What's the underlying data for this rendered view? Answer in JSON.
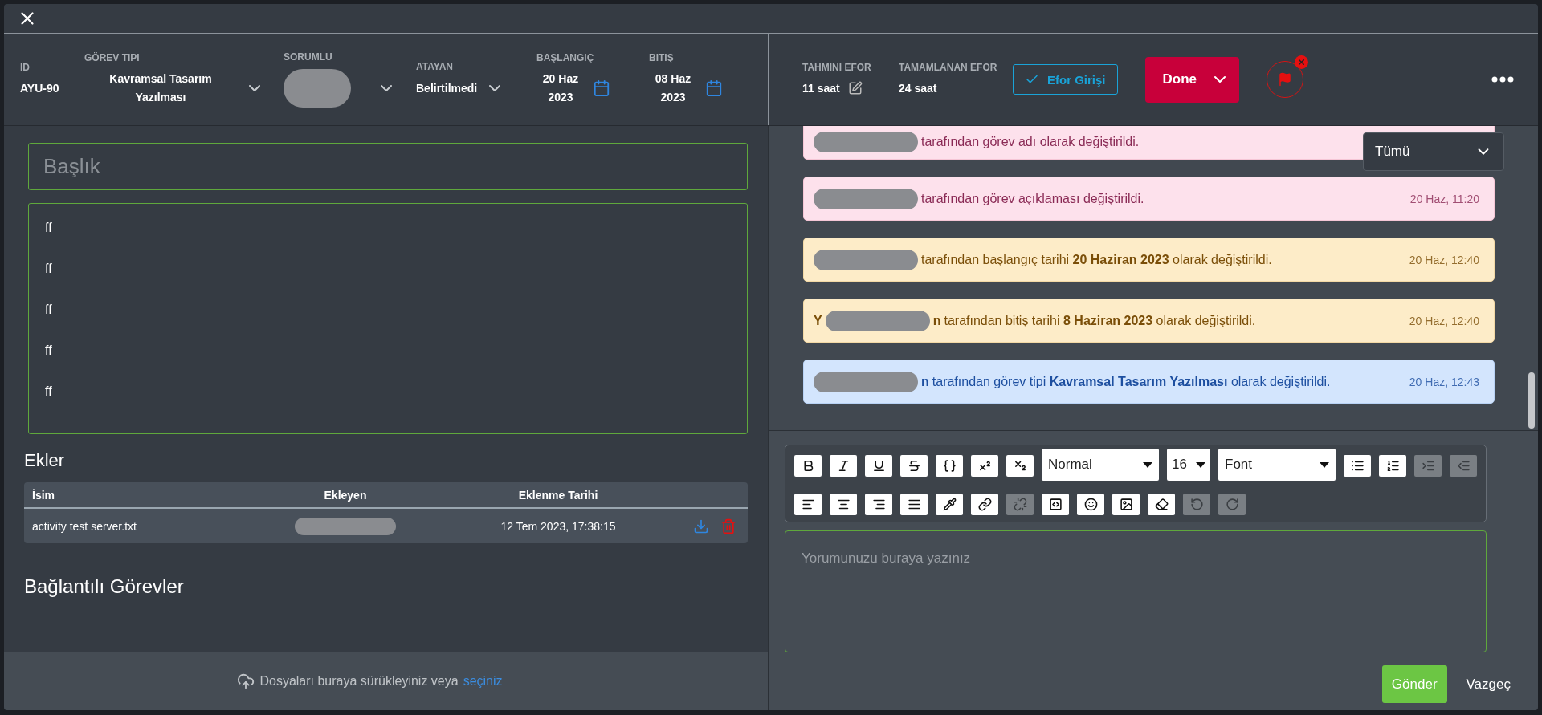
{
  "header": {
    "id": {
      "label": "ID",
      "value": "AYU-90"
    },
    "task_type": {
      "label": "GÖREV TIPI",
      "value": "Kavramsal Tasarım Yazılması"
    },
    "responsible": {
      "label": "SORUMLU"
    },
    "assigner": {
      "label": "ATAYAN",
      "value": "Belirtilmedi"
    },
    "start": {
      "label": "BAŞLANGIÇ",
      "value": "20 Haz 2023"
    },
    "end": {
      "label": "BITIŞ",
      "value": "08 Haz 2023"
    },
    "estimated": {
      "label": "TAHMINI EFOR",
      "value": "11 saat"
    },
    "completed": {
      "label": "TAMAMLANAN EFOR",
      "value": "24 saat"
    },
    "effort_button": "Efor Girişi",
    "status": "Done",
    "flagged": true
  },
  "title_field": {
    "placeholder": "Başlık"
  },
  "description_lines": [
    "ff",
    "ff",
    "ff",
    "ff",
    "ff"
  ],
  "attachments": {
    "heading": "Ekler",
    "columns": [
      "İsim",
      "Ekleyen",
      "Eklenme Tarihi"
    ],
    "rows": [
      {
        "name": "activity test server.txt",
        "date": "12 Tem 2023, 17:38:15"
      }
    ]
  },
  "linked_heading": "Bağlantılı Görevler",
  "upload": {
    "text": "Dosyaları buraya sürükleyiniz veya",
    "link": "seçiniz"
  },
  "filter": "Tümü",
  "activities": [
    {
      "kind": "pink",
      "text": "tarafından görev adı olarak değiştirildi."
    },
    {
      "kind": "pink",
      "text": "tarafından görev açıklaması değiştirildi.",
      "time": "20 Haz, 11:20"
    },
    {
      "kind": "yellow",
      "text": "tarafından başlangıç tarihi **20 Haziran 2023** olarak değiştirildi.",
      "time": "20 Haz, 12:40"
    },
    {
      "kind": "yellow",
      "prefix": "Y",
      "suffix": "n",
      "text": "tarafından bitiş tarihi **8 Haziran 2023** olarak değiştirildi.",
      "time": "20 Haz, 12:40"
    },
    {
      "kind": "blue",
      "suffix": "n",
      "text": "tarafından görev tipi **Kavramsal Tasarım Yazılması** olarak değiştirildi.",
      "time": "20 Haz, 12:43"
    }
  ],
  "toolbar": {
    "style": "Normal",
    "size": "16",
    "font": "Font",
    "tools": [
      {
        "kind": "bold",
        "disabled": false
      },
      {
        "kind": "italic",
        "disabled": false
      },
      {
        "kind": "underline",
        "disabled": false
      },
      {
        "kind": "strike",
        "disabled": false
      },
      {
        "kind": "code",
        "disabled": false
      },
      {
        "kind": "sup",
        "disabled": false
      },
      {
        "kind": "sub",
        "disabled": false
      },
      {
        "kind": "selects"
      },
      {
        "kind": "bullets",
        "disabled": false
      },
      {
        "kind": "numbers",
        "disabled": false
      },
      {
        "kind": "indent",
        "disabled": true
      },
      {
        "kind": "outdent",
        "disabled": true
      },
      {
        "kind": "left",
        "disabled": false
      },
      {
        "kind": "center",
        "disabled": false
      },
      {
        "kind": "right",
        "disabled": false
      },
      {
        "kind": "justify",
        "disabled": false
      },
      {
        "kind": "pen",
        "disabled": false
      },
      {
        "kind": "link",
        "disabled": false
      },
      {
        "kind": "unlink",
        "disabled": true
      },
      {
        "kind": "embed",
        "disabled": false
      },
      {
        "kind": "emoji",
        "disabled": false
      },
      {
        "kind": "image",
        "disabled": false
      },
      {
        "kind": "eraser",
        "disabled": false
      },
      {
        "kind": "undo",
        "disabled": true
      },
      {
        "kind": "redo",
        "disabled": true
      }
    ]
  },
  "comment": {
    "placeholder": "Yorumunuzu buraya yazınız"
  },
  "send_button": "Gönder",
  "cancel_button": "Vazgeç"
}
